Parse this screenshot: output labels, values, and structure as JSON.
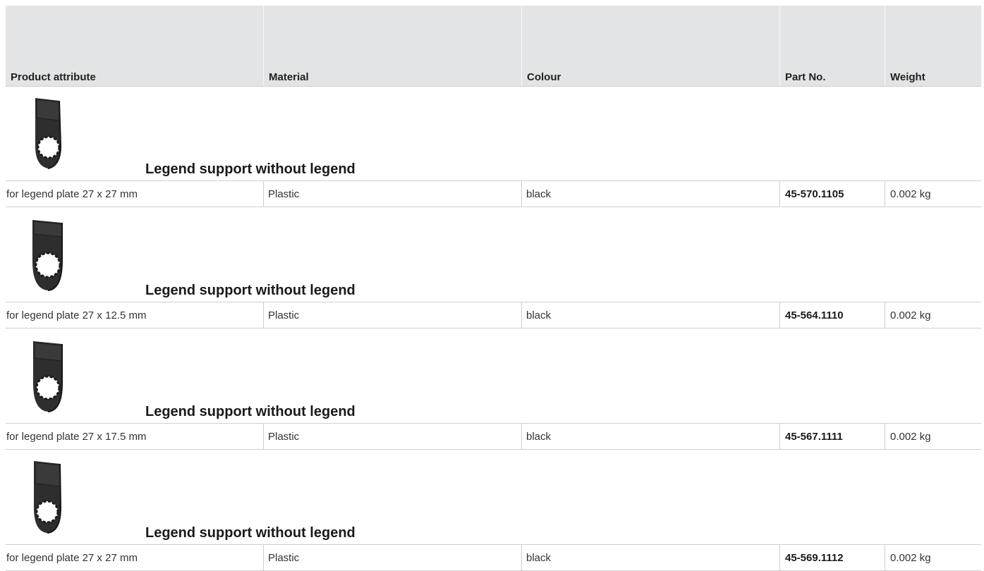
{
  "header": {
    "col_attribute": "Product attribute",
    "col_material": "Material",
    "col_colour": "Colour",
    "col_partno": "Part No.",
    "col_weight": "Weight"
  },
  "groups": [
    {
      "title": "Legend support without legend",
      "image_icon": "legend-support-image",
      "row": {
        "attribute": "for legend plate 27 x 27 mm",
        "material": "Plastic",
        "colour": "black",
        "part_no": "45-570.1105",
        "weight": "0.002 kg"
      }
    },
    {
      "title": "Legend support without legend",
      "image_icon": "legend-support-image",
      "row": {
        "attribute": "for legend plate 27 x 12.5 mm",
        "material": "Plastic",
        "colour": "black",
        "part_no": "45-564.1110",
        "weight": "0.002 kg"
      }
    },
    {
      "title": "Legend support without legend",
      "image_icon": "legend-support-image",
      "row": {
        "attribute": "for legend plate 27 x 17.5 mm",
        "material": "Plastic",
        "colour": "black",
        "part_no": "45-567.1111",
        "weight": "0.002 kg"
      }
    },
    {
      "title": "Legend support without legend",
      "image_icon": "legend-support-image",
      "row": {
        "attribute": "for legend plate 27 x 27 mm",
        "material": "Plastic",
        "colour": "black",
        "part_no": "45-569.1112",
        "weight": "0.002 kg"
      }
    }
  ],
  "colors": {
    "header_bg": "#e3e4e5",
    "border": "#cfcfcf",
    "product": "#2a2a2a"
  }
}
